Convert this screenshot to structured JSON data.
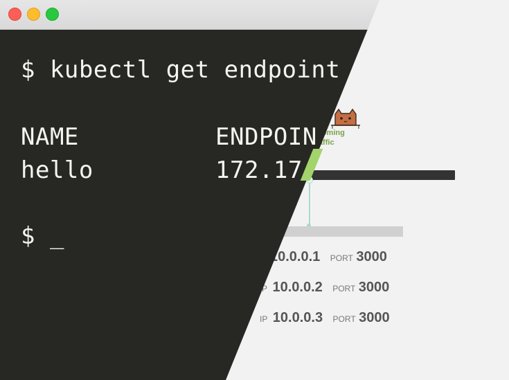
{
  "window": {
    "controls": [
      "close",
      "minimize",
      "maximize"
    ]
  },
  "terminal": {
    "command_line": "$ kubectl get endpoint",
    "header_name": "NAME",
    "header_endpoint": "ENDPOIN",
    "row_name": "hello",
    "row_endpoint": "172.17",
    "prompt": "$ _"
  },
  "diagram": {
    "traffic_label_line1": "ncoming",
    "traffic_label_line2": "traffic",
    "pods": [
      {
        "ip_label": "",
        "ip": "10.0.0.1",
        "port_label": "PORT",
        "port": "3000"
      },
      {
        "ip_label": "P",
        "ip": "10.0.0.2",
        "port_label": "PORT",
        "port": "3000"
      },
      {
        "ip_label": "IP",
        "ip": "10.0.0.3",
        "port_label": "PORT",
        "port": "3000"
      }
    ]
  },
  "colors": {
    "terminal_bg": "#272823",
    "terminal_fg": "#f4f4f0",
    "traffic_green": "#7aa34a",
    "connector": "#a6dcc8"
  }
}
